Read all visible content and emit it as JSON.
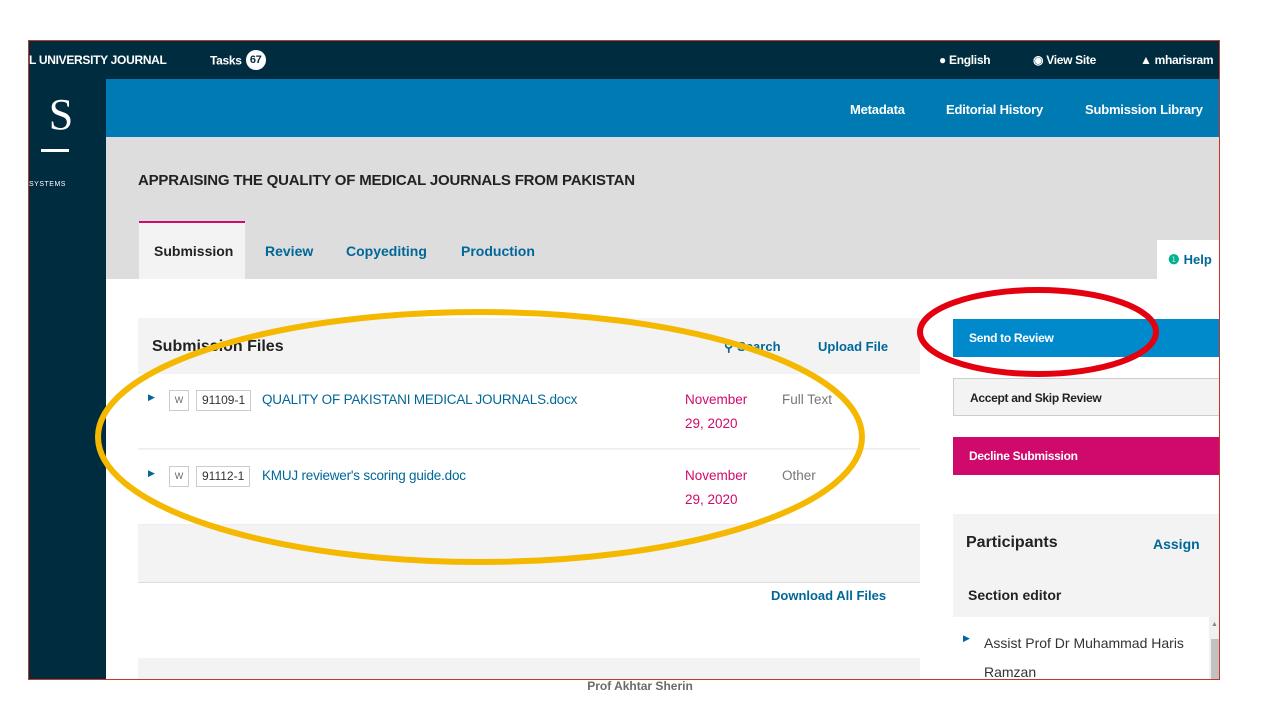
{
  "topbar": {
    "journal_name": "L UNIVERSITY JOURNAL",
    "tasks_label": "Tasks",
    "tasks_count": "67",
    "language": "English",
    "view_site": "View Site",
    "user": "mharisram"
  },
  "logo": {
    "letter": "S",
    "subtitle": "SYSTEMS"
  },
  "nav": {
    "metadata": "Metadata",
    "editorial_history": "Editorial History",
    "submission_library": "Submission Library"
  },
  "submission_title": "APPRAISING THE QUALITY OF MEDICAL JOURNALS FROM PAKISTAN",
  "tabs": [
    {
      "label": "Submission",
      "active": true
    },
    {
      "label": "Review"
    },
    {
      "label": "Copyediting"
    },
    {
      "label": "Production"
    }
  ],
  "help_label": "Help",
  "files": {
    "title": "Submission Files",
    "search": "Search",
    "upload": "Upload File",
    "rows": [
      {
        "id": "91109-1",
        "name": "QUALITY OF PAKISTANI MEDICAL JOURNALS.docx",
        "date": "November 29, 2020",
        "type": "Full Text"
      },
      {
        "id": "91112-1",
        "name": "KMUJ reviewer's scoring guide.doc",
        "date": "November 29, 2020",
        "type": "Other"
      }
    ],
    "download_all": "Download All Files"
  },
  "actions": {
    "send_to_review": "Send to Review",
    "accept_skip": "Accept and Skip Review",
    "decline": "Decline Submission"
  },
  "participants": {
    "title": "Participants",
    "assign": "Assign",
    "section_editor_label": "Section editor",
    "editor_name": "Assist Prof Dr Muhammad Haris Ramzan"
  },
  "annotations": {
    "ellipse_color": "#f5b800",
    "circle_color": "#e3000f"
  },
  "footer_credit": "Prof Akhtar Sherin",
  "colors": {
    "topbar": "#002c40",
    "nav_bar": "#007ab2",
    "link": "#006798",
    "accent_pink": "#d00a6c",
    "primary_button": "#008acb"
  }
}
